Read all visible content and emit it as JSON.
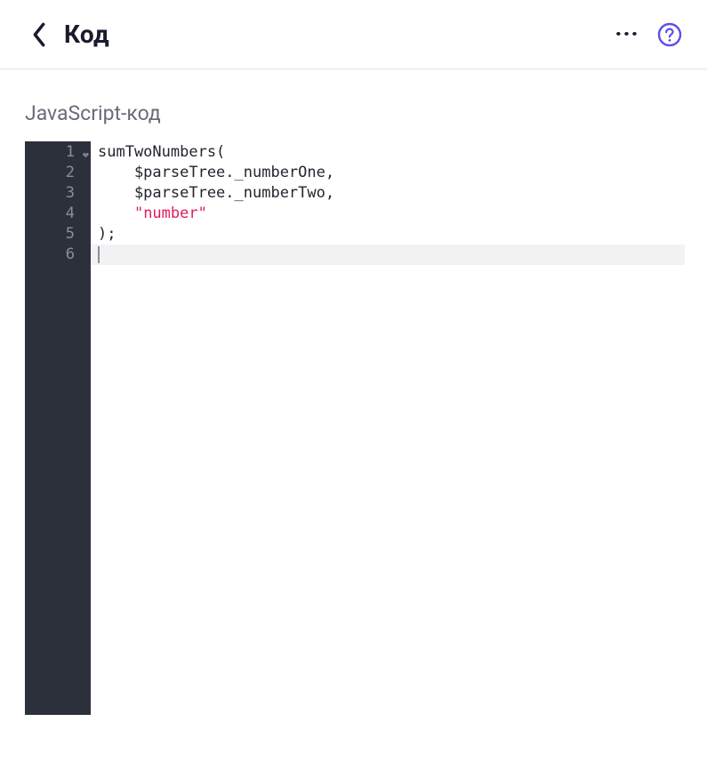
{
  "header": {
    "title": "Код",
    "more_label": "···"
  },
  "section": {
    "label": "JavaScript-код"
  },
  "editor": {
    "line_numbers": [
      "1",
      "2",
      "3",
      "4",
      "5",
      "6"
    ],
    "fold_on_line1": "❤",
    "lines": {
      "l1": "sumTwoNumbers(",
      "l2": "    $parseTree._numberOne,",
      "l3": "    $parseTree._numberTwo,",
      "l4_indent": "    ",
      "l4_string": "\"number\"",
      "l5": ");",
      "l6": ""
    },
    "active_line_index": 5
  }
}
